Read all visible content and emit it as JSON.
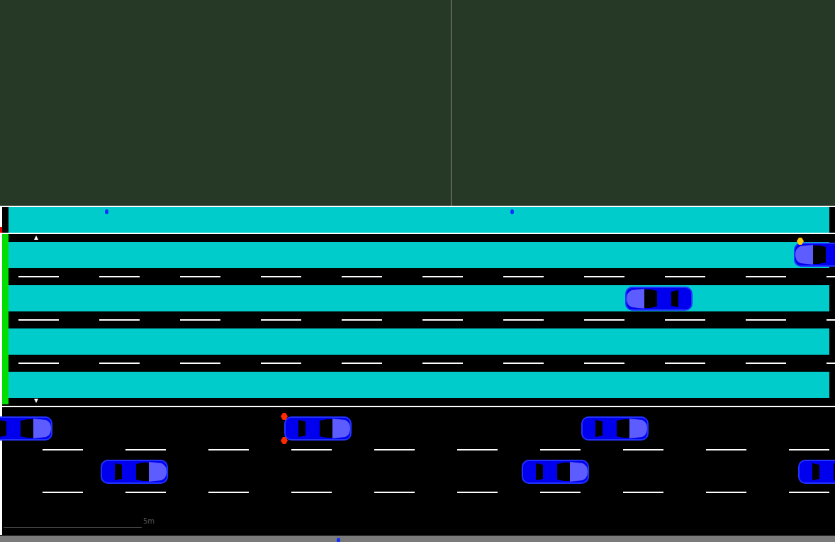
{
  "traffic_light": {
    "state": "green",
    "color": "#00dd00"
  },
  "scale_bar": {
    "label": "5m"
  },
  "cars": [
    {
      "heading": "left",
      "signal": "blink"
    },
    {
      "heading": "left",
      "signal": "none"
    },
    {
      "heading": "right",
      "signal": "none"
    },
    {
      "heading": "right",
      "signal": "brake"
    },
    {
      "heading": "right",
      "signal": "none"
    },
    {
      "heading": "right",
      "signal": "none"
    },
    {
      "heading": "right",
      "signal": "none"
    },
    {
      "heading": "right",
      "signal": "none"
    }
  ]
}
